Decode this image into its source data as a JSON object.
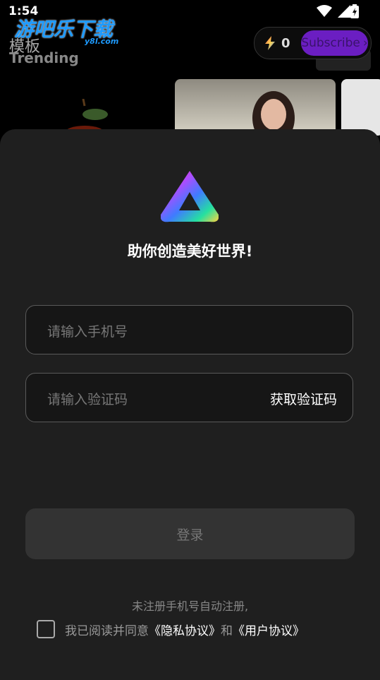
{
  "status_bar": {
    "time": "1:54"
  },
  "watermark": {
    "text": "游吧乐下载",
    "sub": "y8l.com"
  },
  "header": {
    "page_title": "模板",
    "section_title": "Trending"
  },
  "credits": {
    "count": "0",
    "subscribe_label": "Subscribe"
  },
  "login": {
    "headline": "助你创造美好世界!",
    "phone_placeholder": "请输入手机号",
    "code_placeholder": "请输入验证码",
    "get_code_label": "获取验证码",
    "login_label": "登录",
    "notice": "未注册手机号自动注册,",
    "agree_prefix": "我已阅读并同意",
    "privacy_link": "《隐私协议》",
    "and": "和",
    "user_link": "《用户协议》"
  },
  "colors": {
    "accent": "#6b1ec2",
    "sheet_bg": "#1f1f1f"
  }
}
